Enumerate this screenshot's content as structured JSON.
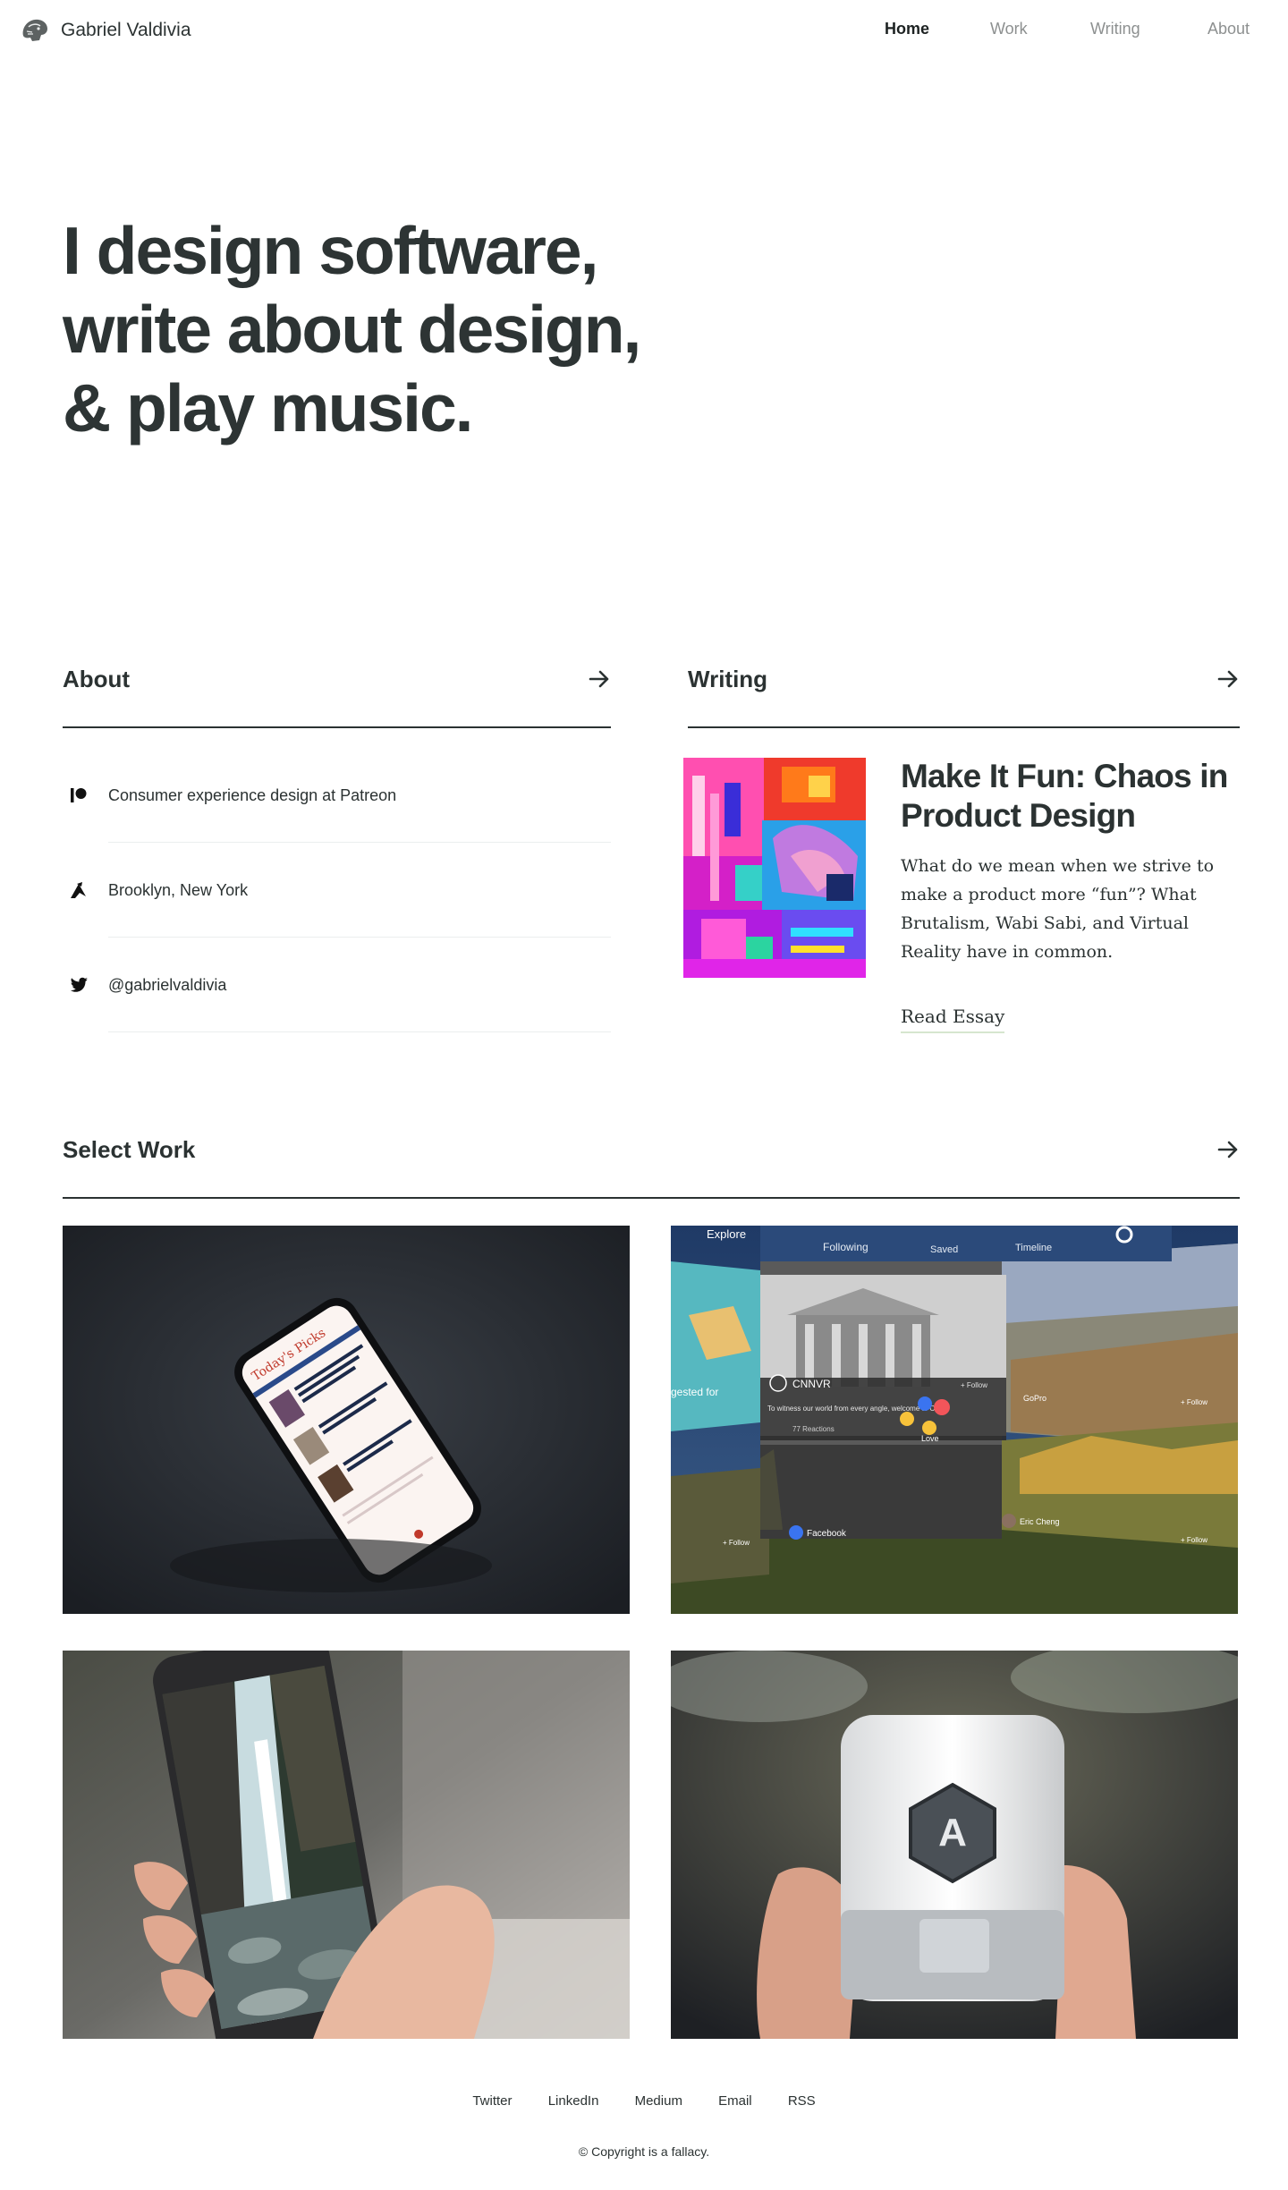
{
  "header": {
    "brand_name": "Gabriel Valdivia",
    "nav": [
      "Home",
      "Work",
      "Writing",
      "About"
    ]
  },
  "hero": {
    "line1": "I design software,",
    "line2": "write about design,",
    "line3": "& play music."
  },
  "about": {
    "title": "About",
    "items": [
      {
        "icon": "patreon-icon",
        "text": "Consumer experience design at Patreon"
      },
      {
        "icon": "location-icon",
        "text": "Brooklyn, New York"
      },
      {
        "icon": "twitter-icon",
        "text": "@gabrielvaldivia"
      }
    ]
  },
  "writing": {
    "title": "Writing",
    "essay": {
      "title": "Make It Fun: Chaos in Product Design",
      "description": "What do we mean when we strive to make a product more “fun”? What Brutalism, Wabi Sabi, and Virtual Reality have in common.",
      "link_label": "Read Essay"
    }
  },
  "work": {
    "title": "Select Work",
    "vr_labels": {
      "tab1": "Explore",
      "tab2": "Following",
      "tab3": "Saved",
      "tab4": "Timeline",
      "card_name": "CNNVR",
      "card_caption": "To witness our world from every angle, welcome to CN..",
      "reactions": "77 Reactions",
      "reaction_label": "Love",
      "follow": "+ Follow",
      "side1": "GoPro",
      "side2": "Facebook",
      "side3": "Eric Cheng",
      "side4": "gested for"
    },
    "phone_labels": {
      "heading": "Today's Picks",
      "item1": "How The Accident Industry Shaped Los Angeles",
      "item2": "Marilyn Monroe By Eric Lutrin"
    },
    "device_letter": "A"
  },
  "footer": {
    "links": [
      "Twitter",
      "LinkedIn",
      "Medium",
      "Email",
      "RSS"
    ],
    "copyright": "© Copyright is a fallacy."
  },
  "colors": {
    "text": "#2b3232",
    "muted": "#8d9090",
    "rule": "#ebeeee",
    "link_underline": "#d6e6cf"
  }
}
